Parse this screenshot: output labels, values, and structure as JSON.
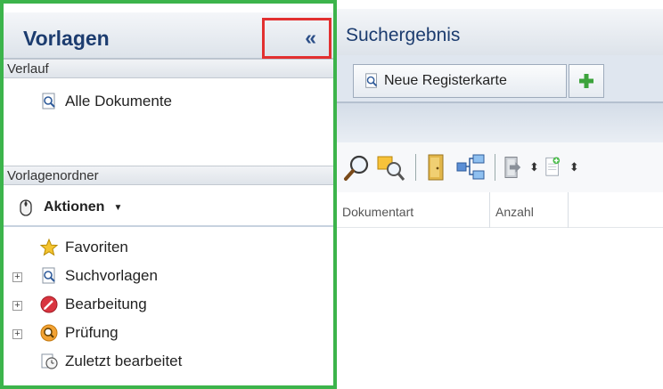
{
  "left": {
    "title": "Vorlagen",
    "collapse_label": "«",
    "history": {
      "header": "Verlauf",
      "items": [
        {
          "label": "Alle Dokumente",
          "icon": "search-doc-icon"
        }
      ]
    },
    "folders": {
      "header": "Vorlagenordner",
      "actions_label": "Aktionen",
      "tree": [
        {
          "label": "Favoriten",
          "icon": "star-icon",
          "expandable": false
        },
        {
          "label": "Suchvorlagen",
          "icon": "search-doc-icon",
          "expandable": true
        },
        {
          "label": "Bearbeitung",
          "icon": "edit-badge-icon",
          "expandable": true
        },
        {
          "label": "Prüfung",
          "icon": "magnifier-badge-icon",
          "expandable": true
        },
        {
          "label": "Zuletzt bearbeitet",
          "icon": "recent-doc-icon",
          "expandable": false
        }
      ]
    }
  },
  "right": {
    "title": "Suchergebnis",
    "tab_label": "Neue Registerkarte",
    "add_tab_icon": "plus-icon",
    "toolbar_icons": [
      "search-icon",
      "find-highlight-icon",
      "door-icon",
      "tree-view-icon",
      "export-icon",
      "new-document-icon"
    ],
    "columns": [
      "Dokumentart",
      "Anzahl"
    ]
  },
  "colors": {
    "panel_border": "#3cb44b",
    "highlight": "#e23030",
    "title": "#1c3c6f"
  }
}
